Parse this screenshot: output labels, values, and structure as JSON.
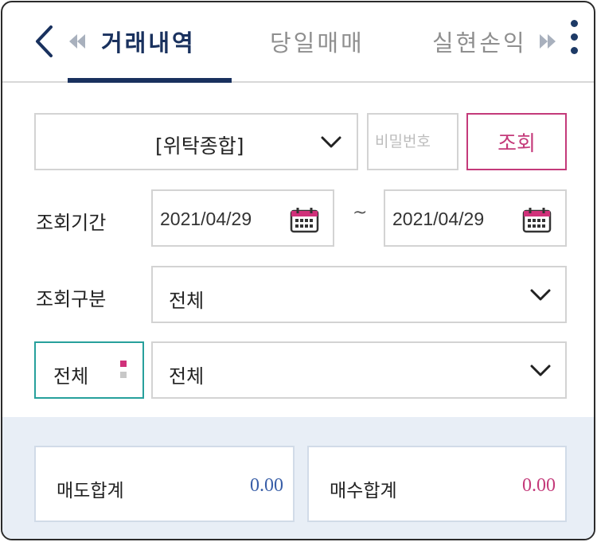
{
  "tabs": [
    {
      "label": "거래내역",
      "active": true
    },
    {
      "label": "당일매매",
      "active": false
    },
    {
      "label": "실현손익",
      "active": false
    }
  ],
  "account": {
    "selected": "[위탁종합]"
  },
  "password": {
    "placeholder": "비밀번호"
  },
  "query_button": "조회",
  "period": {
    "label": "조회기간",
    "start": "2021/04/29",
    "separator": "~",
    "end": "2021/04/29"
  },
  "category": {
    "label": "조회구분",
    "selected": "전체"
  },
  "filter": {
    "left": "전체",
    "selected": "전체"
  },
  "summary": {
    "sell_label": "매도합계",
    "sell_value": "0.00",
    "buy_label": "매수합계",
    "buy_value": "0.00"
  },
  "colors": {
    "navy": "#19315e",
    "accent": "#c43a7a",
    "teal": "#27a09c",
    "blue_value": "#3a5fa8"
  }
}
